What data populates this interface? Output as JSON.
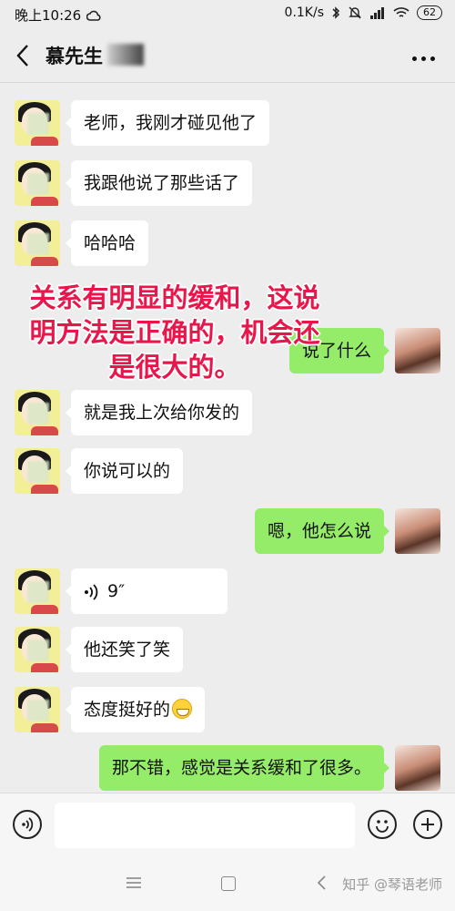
{
  "status_bar": {
    "time": "晚上10:26",
    "network_speed": "0.1K/s",
    "battery": "62"
  },
  "header": {
    "contact_name": "慕先生"
  },
  "messages": [
    {
      "side": "left",
      "text": "老师，我刚才碰见他了"
    },
    {
      "side": "left",
      "text": "我跟他说了那些话了"
    },
    {
      "side": "left",
      "text": "哈哈哈"
    },
    {
      "side": "right",
      "text": "说了什么"
    },
    {
      "side": "left",
      "text": "就是我上次给你发的"
    },
    {
      "side": "left",
      "text": "你说可以的"
    },
    {
      "side": "right",
      "text": "嗯，他怎么说"
    },
    {
      "side": "left",
      "type": "voice",
      "text": "9″"
    },
    {
      "side": "left",
      "text": "他还笑了笑"
    },
    {
      "side": "left",
      "text": "态度挺好的",
      "emoji": "grinning-face"
    },
    {
      "side": "right",
      "text": "那不错，感觉是关系缓和了很多。"
    }
  ],
  "overlay": {
    "line1": "关系有明显的缓和，这说",
    "line2": "明方法是正确的，机会还",
    "line3": "是很大的。",
    "color": "#e8174b"
  },
  "footer": {
    "watermark": "知乎 @琴语老师"
  },
  "colors": {
    "sent_bubble": "#95ec69",
    "received_bubble": "#ffffff",
    "background": "#ededed"
  }
}
